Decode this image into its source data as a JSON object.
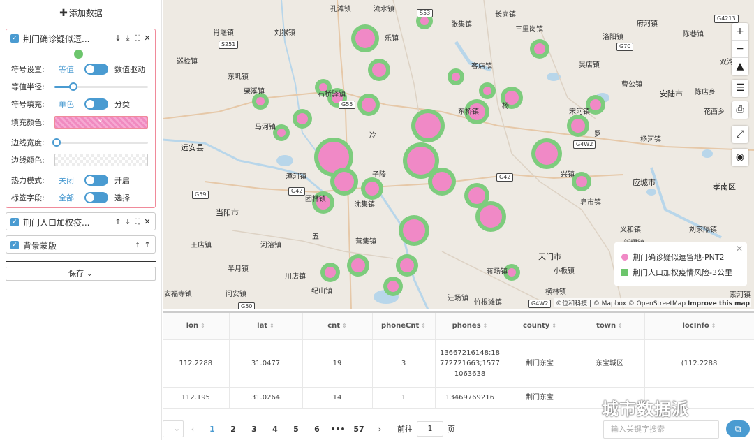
{
  "sidebar": {
    "add_data": "添加数据",
    "layers": [
      {
        "name": "荆门确诊疑似逗..."
      },
      {
        "name": "荆门人口加权疫..."
      },
      {
        "name": "背景蒙版"
      }
    ],
    "settings": {
      "symbol_label": "符号设置:",
      "symbol_left": "等值",
      "symbol_right": "数值驱动",
      "radius_label": "等值半径:",
      "radius_value": 0.2,
      "fill_label": "符号填充:",
      "fill_left": "单色",
      "fill_right": "分类",
      "fill_color_label": "填充颜色:",
      "fill_color": "#f08ac0",
      "border_width_label": "边线宽度:",
      "border_width_value": 0,
      "border_color_label": "边线颜色:",
      "heat_label": "热力模式:",
      "heat_left": "关闭",
      "heat_right": "开启",
      "tag_label": "标签字段:",
      "tag_left": "全部",
      "tag_right": "选择"
    },
    "save": "保存"
  },
  "map": {
    "labels": [
      "孔滩镇",
      "流水镇",
      "张集镇",
      "长岗镇",
      "三里岗镇",
      "府河镇",
      "陈巷镇",
      "肖堰镇",
      "刘猴镇",
      "乐镇",
      "洛阳镇",
      "双沟",
      "巡检镇",
      "东巩镇",
      "客店镇",
      "吴店镇",
      "栗溪镇",
      "石桥驿镇",
      "东桥镇",
      "杨",
      "曹公镇",
      "安陆市",
      "陈店乡",
      "花西乡",
      "马河镇",
      "冷",
      "宋河镇",
      "罗",
      "杨河镇",
      "远安县",
      "漳河镇",
      "子陵",
      "兴镇",
      "应城市",
      "孝南区",
      "当阳市",
      "沈集镇",
      "皂市镇",
      "王店镇",
      "河溶镇",
      "营集镇",
      "天门市",
      "义和镇",
      "刘家隔镇",
      "新堰镇",
      "半月镇",
      "川店镇",
      "蒋场镇",
      "小板镇",
      "纪山镇",
      "汪场镇",
      "竹根滩镇",
      "横林镇",
      "安福寺镇",
      "问安镇",
      "索河镇",
      "团林镇",
      "五"
    ],
    "shields": [
      "S251",
      "S53",
      "G70",
      "G4213",
      "G55",
      "G4W2",
      "G59",
      "G42",
      "G42",
      "G50",
      "G4W2"
    ],
    "attribution": "©位和科技 | © Mapbox © OpenStreetMap",
    "improve": "Improve this map",
    "legend": [
      {
        "label": "荆门确诊疑似逗留地-PNT2",
        "color": "#f089c6"
      },
      {
        "label": "荆门人口加权疫情风险-3公里",
        "color": "#6cc56c"
      }
    ]
  },
  "table": {
    "columns": [
      "lon",
      "lat",
      "cnt",
      "phoneCnt",
      "phones",
      "county",
      "town",
      "locInfo"
    ],
    "rows": [
      [
        "112.2288",
        "31.0477",
        "19",
        "3",
        "13667216148;18772721663;15771063638",
        "荆门东宝",
        "东宝城区",
        "(112.2288"
      ],
      [
        "112.195",
        "31.0264",
        "14",
        "1",
        "13469769216",
        "荆门东宝",
        "",
        ""
      ]
    ]
  },
  "pager": {
    "pages": [
      "1",
      "2",
      "3",
      "4",
      "5",
      "6",
      "•••",
      "57"
    ],
    "goto": "前往",
    "goto_value": "1",
    "page_unit": "页",
    "search_placeholder": "输入关键字搜索"
  },
  "watermark": "城市数据派"
}
